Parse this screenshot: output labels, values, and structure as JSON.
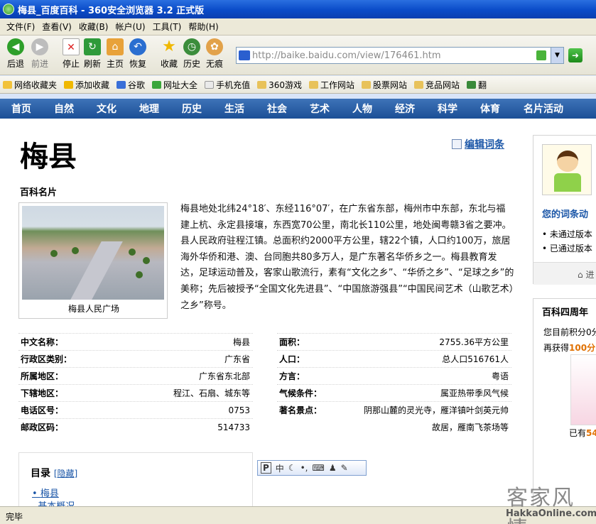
{
  "window": {
    "title": "梅县_百度百科 - 360安全浏览器 3.2 正式版"
  },
  "menu": [
    "文件(F)",
    "查看(V)",
    "收藏(B)",
    "帐户(U)",
    "工具(T)",
    "帮助(H)"
  ],
  "toolbar": {
    "back": "后退",
    "forward": "前进",
    "stop": "停止",
    "refresh": "刷新",
    "home": "主页",
    "restore": "恢复",
    "favorites": "收藏",
    "history": "历史",
    "trace": "无痕"
  },
  "address": {
    "url": "http://baike.baidu.com/view/176461.htm"
  },
  "favbar": [
    "网络收藏夹",
    "添加收藏",
    "谷歌",
    "网址大全",
    "手机充值",
    "360游戏",
    "工作网站",
    "股票网站",
    "竞品网站",
    "翻"
  ],
  "nav": [
    "首页",
    "自然",
    "文化",
    "地理",
    "历史",
    "生活",
    "社会",
    "艺术",
    "人物",
    "经济",
    "科学",
    "体育",
    "名片活动"
  ],
  "article": {
    "title": "梅县",
    "edit": "编辑词条",
    "card_title": "百科名片",
    "photo_caption": "梅县人民广场",
    "intro": "梅县地处北纬24°18′、东经116°07′，在广东省东部，梅州市中东部，东北与福建上杭、永定县接壤，东西宽70公里，南北长110公里，地处闽粤赣3省之要冲。县人民政府驻程江镇。总面积约2000平方公里，辖22个镇，人口约100万，旅居海外华侨和港、澳、台同胞共80多万人，是广东著名华侨乡之一。梅县教育发达，足球运动普及，客家山歌流行，素有“文化之乡”、“华侨之乡”、“足球之乡”的美称；先后被授予“全国文化先进县”、“中国旅游强县”“中国民间艺术（山歌艺术）之乡”称号。"
  },
  "info_left": [
    {
      "k": "中文名称：",
      "v": "梅县"
    },
    {
      "k": "行政区类别：",
      "v": "广东省"
    },
    {
      "k": "所属地区：",
      "v": "广东省东北部"
    },
    {
      "k": "下辖地区：",
      "v": "程江、石扇、城东等"
    },
    {
      "k": "电话区号：",
      "v": "0753"
    },
    {
      "k": "邮政区码：",
      "v": "514733"
    }
  ],
  "info_right": [
    {
      "k": "面积：",
      "v": "2755.36平方公里"
    },
    {
      "k": "人口：",
      "v": "总人口516761人"
    },
    {
      "k": "方言：",
      "v": "粤语"
    },
    {
      "k": "气候条件：",
      "v": "属亚热带季风气候"
    },
    {
      "k": "著名景点：",
      "v": "阴那山麓的灵光寺，雁洋镇叶剑英元帅"
    },
    {
      "k": "",
      "v": "故居，雁南飞茶场等"
    }
  ],
  "toc": {
    "title": "目录",
    "hide": "[隐藏]",
    "items": [
      "梅县",
      "基本概况"
    ]
  },
  "ime": [
    "中",
    "•,",
    "⌨"
  ],
  "sidebar": {
    "title": "您的词条动",
    "line1": "未通过版本",
    "line2": "已通过版本",
    "bar": "进",
    "promo_title": "百科四周年",
    "promo_a": "您目前积分0分",
    "promo_b_pre": "再获得",
    "promo_b_val": "100分",
    "promo_c_pre": "已有",
    "promo_c_val": "54"
  },
  "status": "完毕",
  "watermark": {
    "text1": "客家风情",
    "text2": "HakkaOnline.com"
  },
  "colors": {
    "nav": "#1b4f96",
    "link": "#1c57a8",
    "titlebar": "#0a4bc8"
  }
}
